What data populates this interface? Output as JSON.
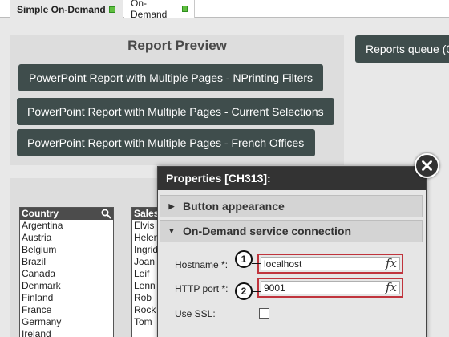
{
  "tabs": [
    {
      "label": "Simple On-Demand",
      "active": true
    },
    {
      "label": "On-Demand",
      "active": false
    }
  ],
  "report_preview": {
    "title": "Report Preview",
    "buttons": [
      "PowerPoint Report with Multiple Pages - NPrinting Filters",
      "PowerPoint Report with Multiple Pages - Current Selections",
      "PowerPoint Report with Multiple Pages - French Offices"
    ]
  },
  "reports_queue_label": "Reports queue (0",
  "country_list": {
    "header": "Country",
    "items": [
      "Argentina",
      "Austria",
      "Belgium",
      "Brazil",
      "Canada",
      "Denmark",
      "Finland",
      "France",
      "Germany",
      "Ireland"
    ]
  },
  "sales_list": {
    "header": "Sales",
    "items": [
      "Elvis",
      "Helen",
      "Ingrid",
      "Joan",
      "Leif",
      "Lenn",
      "Rob",
      "Rock",
      "Tom"
    ]
  },
  "dialog": {
    "title": "Properties [CH313]:",
    "section_button_appearance": "Button appearance",
    "section_service_connection": "On-Demand service connection",
    "hostname_label": "Hostname *:",
    "hostname_value": "localhost",
    "http_port_label": "HTTP port *:",
    "http_port_value": "9001",
    "use_ssl_label": "Use SSL:",
    "use_ssl_checked": false,
    "fx_glyph": "fx",
    "callout_1": "1",
    "callout_2": "2"
  },
  "colors": {
    "button_bg": "#3f4d4c",
    "status_green": "#5fbf3f",
    "highlight_red": "#c0343d"
  }
}
